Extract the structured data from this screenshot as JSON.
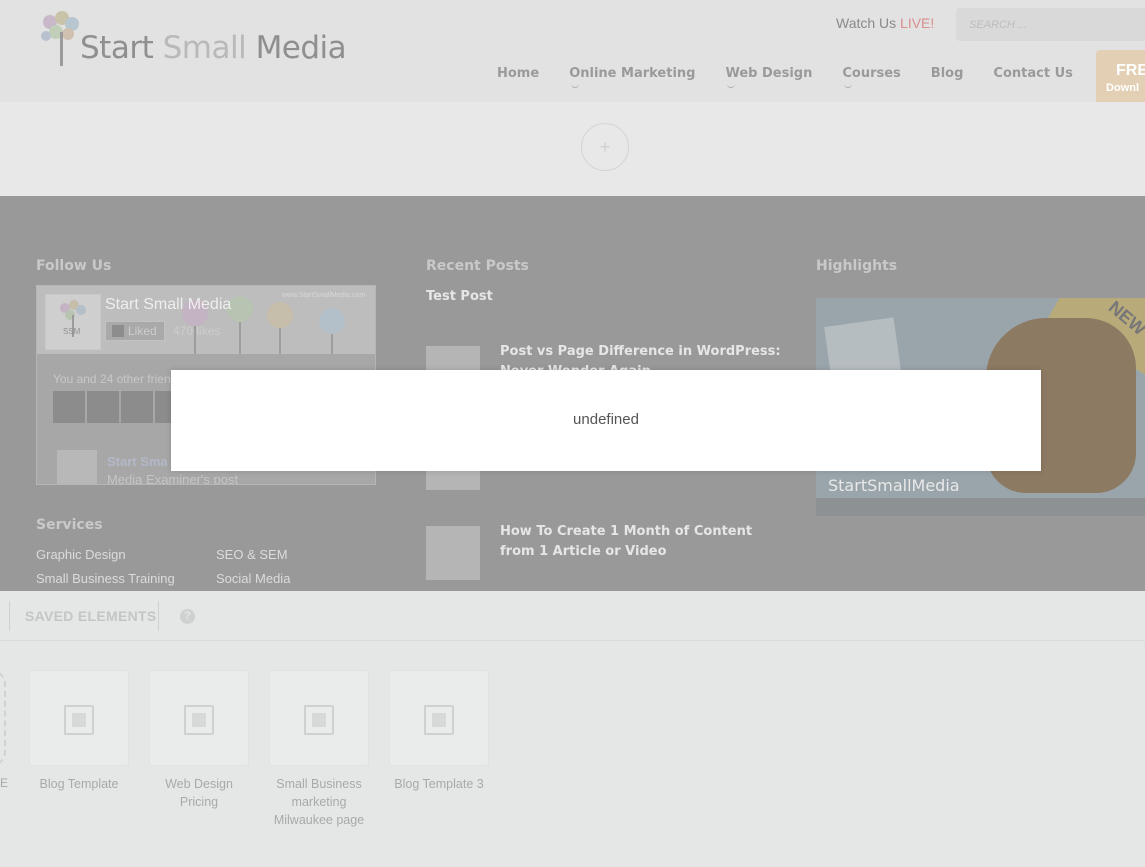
{
  "header": {
    "logo_text_1": "Start",
    "logo_text_2": "Small",
    "logo_text_3": "Media",
    "watch_label": "Watch Us",
    "watch_live": "LIVE!",
    "search_placeholder": "SEARCH ...",
    "nav": [
      "Home",
      "Online Marketing",
      "Web Design",
      "Courses",
      "Blog",
      "Contact Us"
    ],
    "free_title": "FRE",
    "free_sub": "Downl"
  },
  "add_button": "+",
  "footer": {
    "follow_title": "Follow Us",
    "fb": {
      "thumb_text": "SSM",
      "name": "Start Small Media",
      "liked": "Liked",
      "likes": "470 likes",
      "url": "www.StartSmallMedia.com",
      "friends": "You and 24 other frien",
      "post_name": "Start Sma",
      "post_sub": "Media Examiner's post"
    },
    "recent_title": "Recent Posts",
    "recent_first": "Test Post",
    "recent_posts": [
      "Post vs Page Difference in WordPress: Never Wonder Again",
      "How To Create 1 Month of Content from 1 Article or Video"
    ],
    "highlights_title": "Highlights",
    "highlight_brand": "StartSmallMedia",
    "highlight_new": "NEW",
    "services_title": "Services",
    "services": [
      "Graphic Design",
      "SEO & SEM",
      "Small Business Training",
      "Social Media"
    ]
  },
  "modal": {
    "text": "undefined"
  },
  "panel": {
    "tab_saved": "SAVED ELEMENTS",
    "help": "?",
    "partial_label": "E",
    "cards": [
      "Blog Template",
      "Web Design Pricing",
      "Small Business marketing Milwaukee page",
      "Blog Template 3"
    ]
  }
}
